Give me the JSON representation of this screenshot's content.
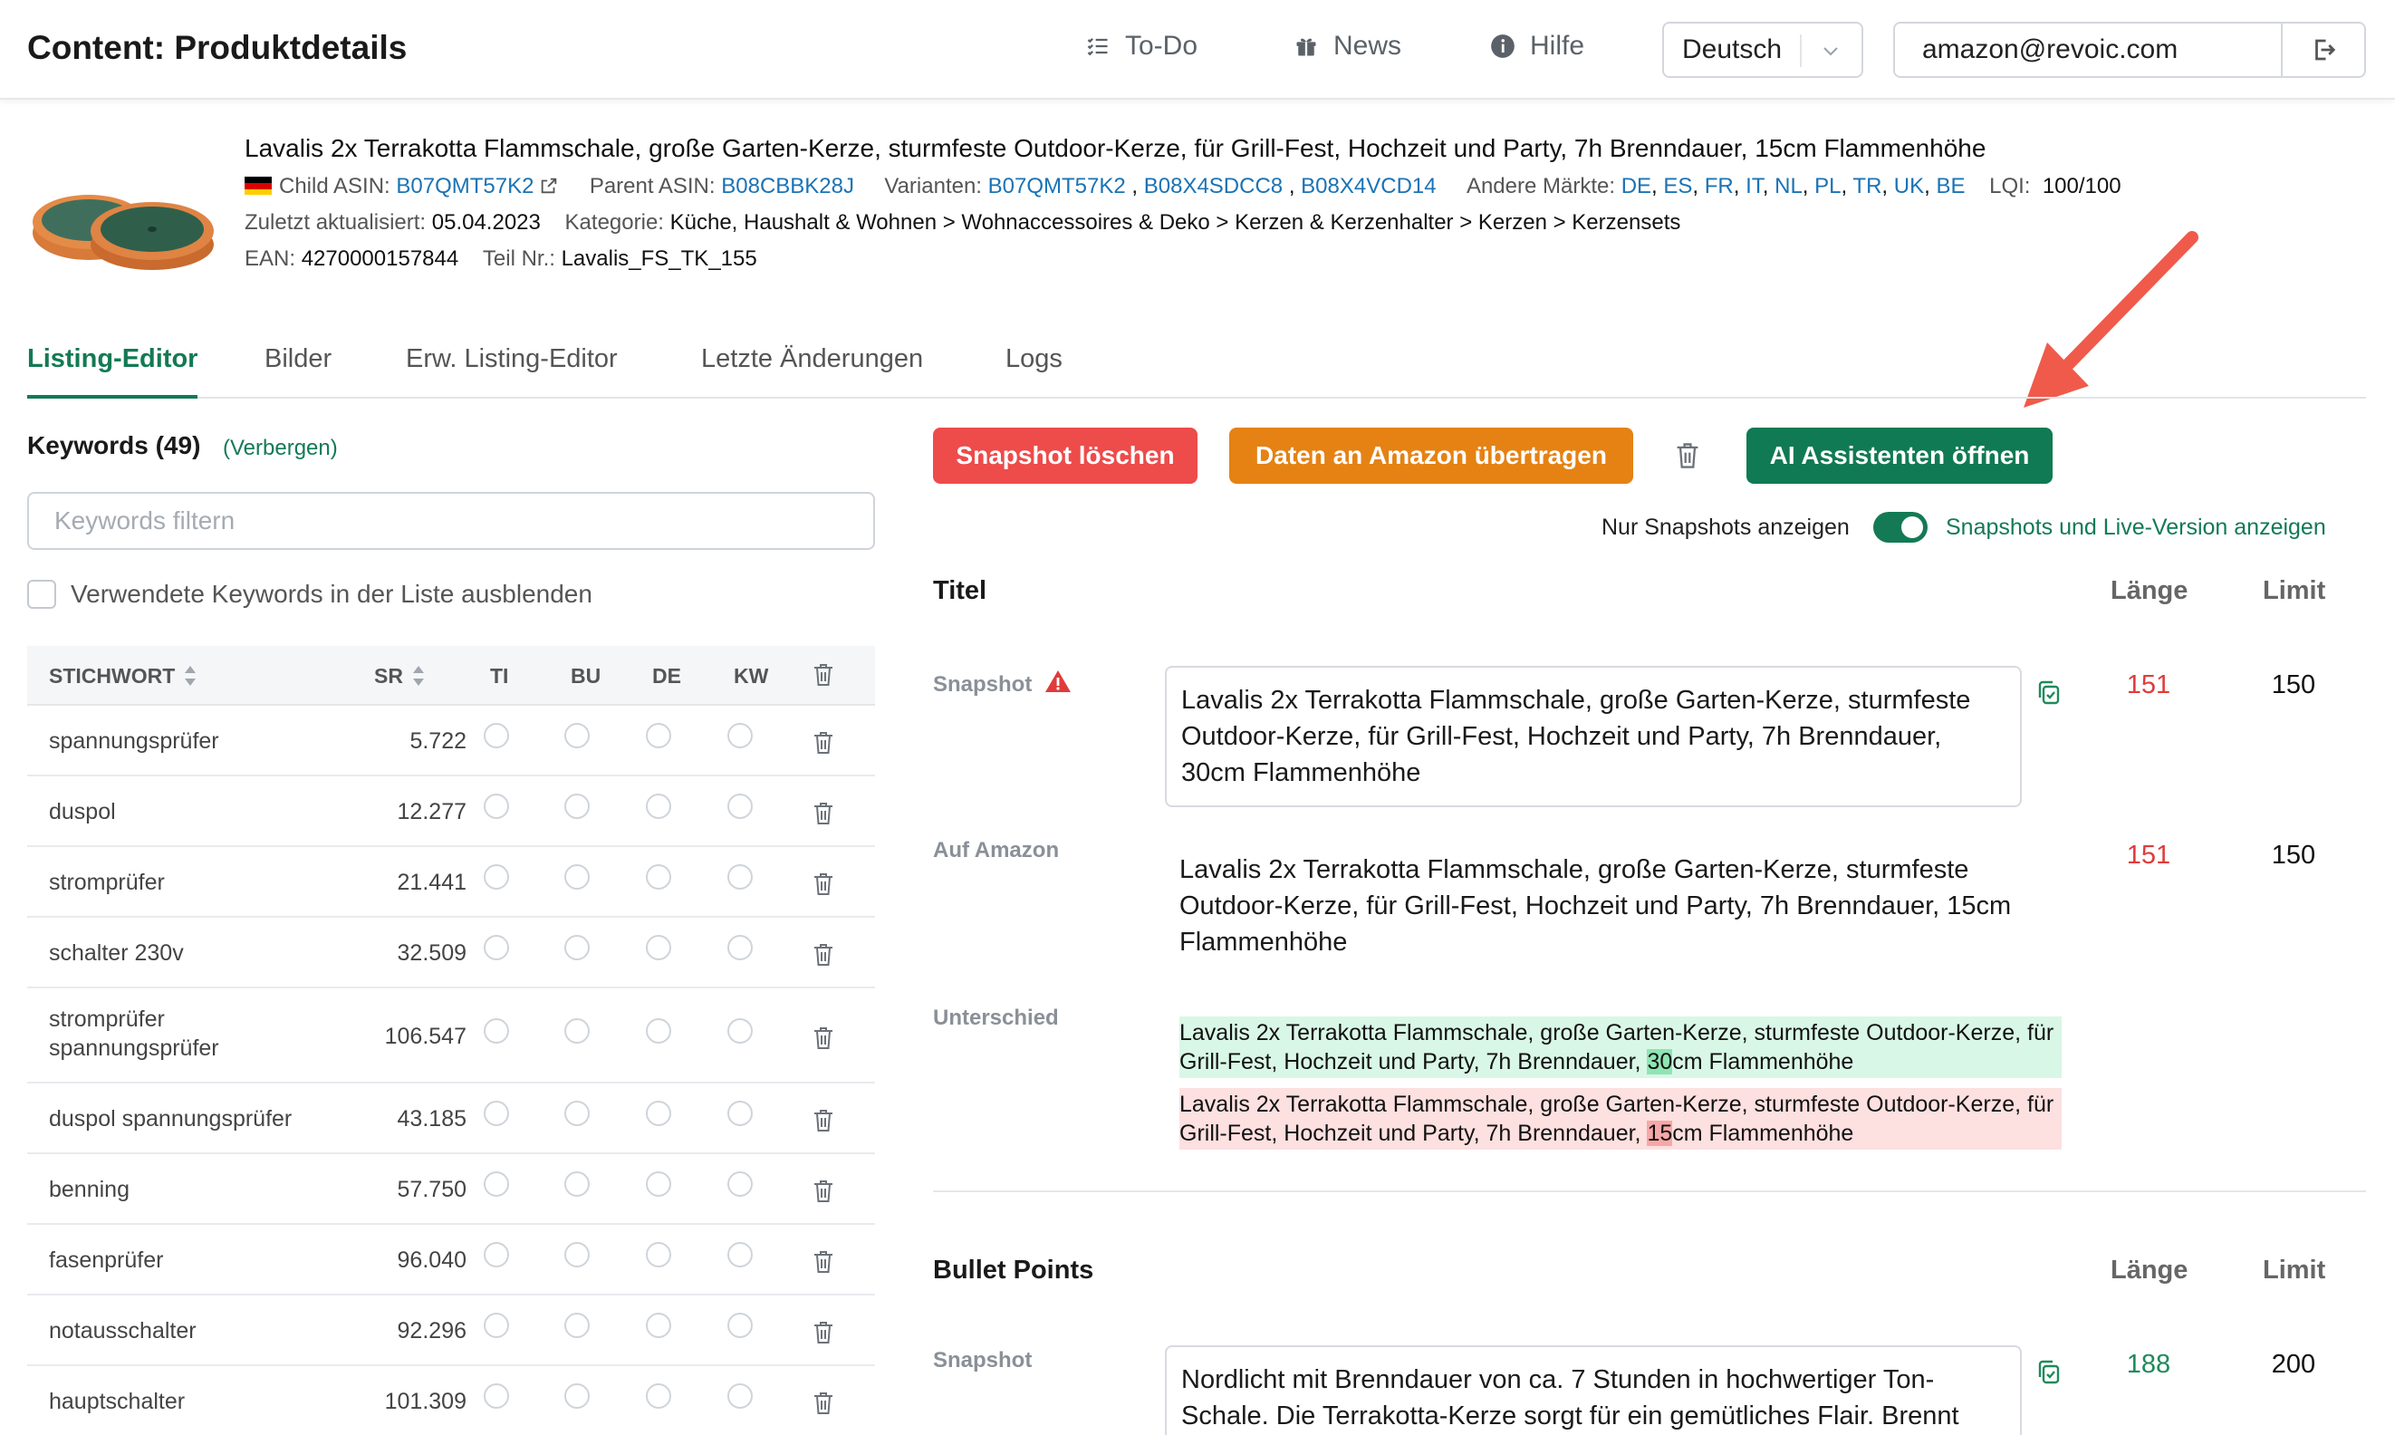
{
  "header": {
    "title": "Content: Produktdetails",
    "nav": [
      {
        "label": "To-Do",
        "icon": "list-check-icon"
      },
      {
        "label": "News",
        "icon": "gift-icon"
      },
      {
        "label": "Hilfe",
        "icon": "info-icon"
      }
    ],
    "language": "Deutsch",
    "email": "amazon@revoic.com"
  },
  "product": {
    "title": "Lavalis 2x Terrakotta Flammschale, große Garten-Kerze, sturmfeste Outdoor-Kerze, für Grill-Fest, Hochzeit und Party, 7h Brenndauer, 15cm Flammenhöhe",
    "child_asin_label": "Child ASIN:",
    "child_asin": "B07QMT57K2",
    "parent_asin_label": "Parent ASIN:",
    "parent_asin": "B08CBBK28J",
    "variants_label": "Varianten:",
    "variants": [
      "B07QMT57K2",
      "B08X4SDCC8",
      "B08X4VCD14"
    ],
    "markets_label": "Andere Märkte:",
    "markets": [
      "DE",
      "ES",
      "FR",
      "IT",
      "NL",
      "PL",
      "TR",
      "UK",
      "BE"
    ],
    "lqi_label": "LQI:",
    "lqi": "100/100",
    "updated_label": "Zuletzt aktualisiert:",
    "updated": "05.04.2023",
    "category_label": "Kategorie:",
    "category": "Küche, Haushalt & Wohnen > Wohnaccessoires & Deko > Kerzen & Kerzenhalter > Kerzen > Kerzensets",
    "ean_label": "EAN:",
    "ean": "4270000157844",
    "part_label": "Teil Nr.:",
    "part": "Lavalis_FS_TK_155"
  },
  "tabs": [
    "Listing-Editor",
    "Bilder",
    "Erw. Listing-Editor",
    "Letzte Änderungen",
    "Logs"
  ],
  "keywords": {
    "title": "Keywords (49)",
    "hide_label": "(Verbergen)",
    "filter_placeholder": "Keywords filtern",
    "checkbox_label": "Verwendete Keywords in der Liste ausblenden",
    "columns": [
      "STICHWORT",
      "SR",
      "TI",
      "BU",
      "DE",
      "KW"
    ],
    "rows": [
      {
        "keyword": "spannungsprüfer",
        "sr": "5.722"
      },
      {
        "keyword": "duspol",
        "sr": "12.277"
      },
      {
        "keyword": "stromprüfer",
        "sr": "21.441"
      },
      {
        "keyword": "schalter 230v",
        "sr": "32.509"
      },
      {
        "keyword": "stromprüfer spannungsprüfer",
        "sr": "106.547"
      },
      {
        "keyword": "duspol spannungsprüfer",
        "sr": "43.185"
      },
      {
        "keyword": "benning",
        "sr": "57.750"
      },
      {
        "keyword": "fasenprüfer",
        "sr": "96.040"
      },
      {
        "keyword": "notausschalter",
        "sr": "92.296"
      },
      {
        "keyword": "hauptschalter",
        "sr": "101.309"
      }
    ]
  },
  "actions": {
    "delete_snapshot": "Snapshot löschen",
    "send_to_amazon": "Daten an Amazon übertragen",
    "open_ai": "AI Assistenten öffnen"
  },
  "toggle": {
    "left_label": "Nur Snapshots anzeigen",
    "right_label": "Snapshots und Live-Version anzeigen",
    "state": "right"
  },
  "title_section": {
    "heading": "Titel",
    "length_label": "Länge",
    "limit_label": "Limit",
    "snapshot_label": "Snapshot",
    "snapshot_text": "Lavalis 2x Terrakotta Flammschale, große Garten-Kerze, sturmfeste Outdoor-Kerze, für Grill-Fest, Hochzeit und Party, 7h Brenndauer, 30cm Flammenhöhe",
    "snapshot_length": "151",
    "snapshot_limit": "150",
    "amazon_label": "Auf Amazon",
    "amazon_text": "Lavalis 2x Terrakotta Flammschale, große Garten-Kerze, sturmfeste Outdoor-Kerze, für Grill-Fest, Hochzeit und Party, 7h Brenndauer, 15cm Flammenhöhe",
    "amazon_length": "151",
    "amazon_limit": "150",
    "diff_label": "Unterschied",
    "diff_add_pre": "Lavalis 2x Terrakotta Flammschale, große Garten-Kerze, sturmfeste Outdoor-Kerze, für Grill-Fest, Hochzeit und Party, 7h Brenndauer, ",
    "diff_add_hl": "30",
    "diff_add_post": "cm Flammenhöhe",
    "diff_del_pre": "Lavalis 2x Terrakotta Flammschale, große Garten-Kerze, sturmfeste Outdoor-Kerze, für Grill-Fest, Hochzeit und Party, 7h Brenndauer, ",
    "diff_del_hl": "15",
    "diff_del_post": "cm Flammenhöhe"
  },
  "bullets_section": {
    "heading": "Bullet Points",
    "length_label": "Länge",
    "limit_label": "Limit",
    "snapshot_label": "Snapshot",
    "snapshot_text": "Nordlicht mit Brenndauer von ca. 7 Stunden in hochwertiger Ton-Schale. Die Terrakotta-Kerze sorgt für ein gemütliches Flair. Brennt",
    "snapshot_length": "188",
    "snapshot_limit": "200"
  },
  "colors": {
    "accent_green": "#137a55",
    "danger_red": "#ee4b4b",
    "orange": "#e58213",
    "link_blue": "#1a73b5",
    "arrow_red": "#f05a4a"
  }
}
